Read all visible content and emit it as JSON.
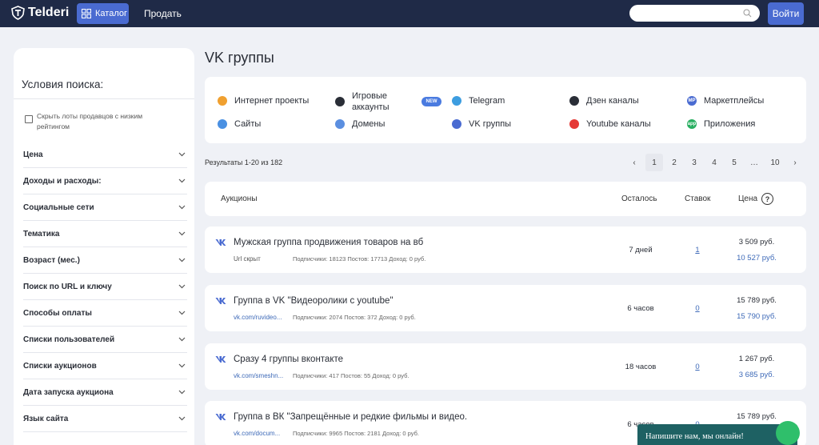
{
  "header": {
    "logo": "Telderi",
    "catalog": "Каталог",
    "sell": "Продать",
    "login": "Войти",
    "search_placeholder": ""
  },
  "sidebar": {
    "title": "Условия поиска:",
    "hide_low_rating": "Скрыть лоты продавцов с низким рейтингом",
    "filters": [
      "Цена",
      "Доходы и расходы:",
      "Социальные сети",
      "Тематика",
      "Возраст (мес.)",
      "Поиск по URL и ключу",
      "Способы оплаты",
      "Списки пользователей",
      "Списки аукционов",
      "Дата запуска аукциона",
      "Язык сайта"
    ]
  },
  "page": {
    "title": "VK группы",
    "results": "Результаты 1-20 из 182"
  },
  "categories": [
    {
      "label": "Интернет проекты",
      "icon": "internet-projects-icon",
      "color": "#f0a030"
    },
    {
      "label": "Сайты",
      "icon": "globe-icon",
      "color": "#4a90e2"
    },
    {
      "label": "Игровые аккаунты",
      "icon": "gamepad-icon",
      "color": "#2a2e37"
    },
    {
      "label": "Домены",
      "icon": "domain-globe-icon",
      "color": "#5b8fe0"
    },
    {
      "label": "Telegram",
      "icon": "telegram-icon",
      "color": "#3d9de0"
    },
    {
      "label": "VK группы",
      "icon": "vk-icon",
      "color": "#4a6bd1"
    },
    {
      "label": "Дзен каналы",
      "icon": "dzen-icon",
      "color": "#2a2e37"
    },
    {
      "label": "Youtube каналы",
      "icon": "youtube-icon",
      "color": "#e53935"
    },
    {
      "label": "Маркетплейсы",
      "icon": "marketplace-icon",
      "color": "#4a6bd1",
      "badge": "MP"
    },
    {
      "label": "Приложения",
      "icon": "apps-icon",
      "color": "#27ae60",
      "badge": "app"
    }
  ],
  "new_badge": "NEW",
  "pagination": [
    "‹",
    "1",
    "2",
    "3",
    "4",
    "5",
    "…",
    "10",
    "›"
  ],
  "table": {
    "col_auction": "Аукционы",
    "col_left": "Осталось",
    "col_bids": "Ставок",
    "col_price": "Цена",
    "help": "?"
  },
  "rows": [
    {
      "title": "Мужская группа продвижения товаров на вб",
      "url": "Url скрыт",
      "stats": "Подписчики: 18123   Постов: 17713   Доход: 0 руб.",
      "left": "7 дней",
      "bids": "1",
      "price": "3 509 руб.",
      "buyout": "10 527 руб."
    },
    {
      "title": "Группа в VK \"Видеоролики с youtube\"",
      "url": "vk.com/ruvideo...",
      "stats": "Подписчики: 2074   Постов: 372   Доход: 0 руб.",
      "left": "6 часов",
      "bids": "0",
      "price": "15 789 руб.",
      "buyout": "15 790 руб."
    },
    {
      "title": "Сразу 4 группы вконтакте",
      "url": "vk.com/smeshn...",
      "stats": "Подписчики: 417   Постов: 55   Доход: 0 руб.",
      "left": "18 часов",
      "bids": "0",
      "price": "1 267 руб.",
      "buyout": "3 685 руб."
    },
    {
      "title": "Группа в ВК \"Запрещённые и редкие фильмы и видео.",
      "url": "vk.com/docum...",
      "stats": "Подписчики: 9965   Постов: 2181   Доход: 0 руб.",
      "left": "6 часов",
      "bids": "0",
      "price": "15 789 руб.",
      "buyout": ""
    }
  ],
  "chat": "Напишите нам, мы онлайн!"
}
